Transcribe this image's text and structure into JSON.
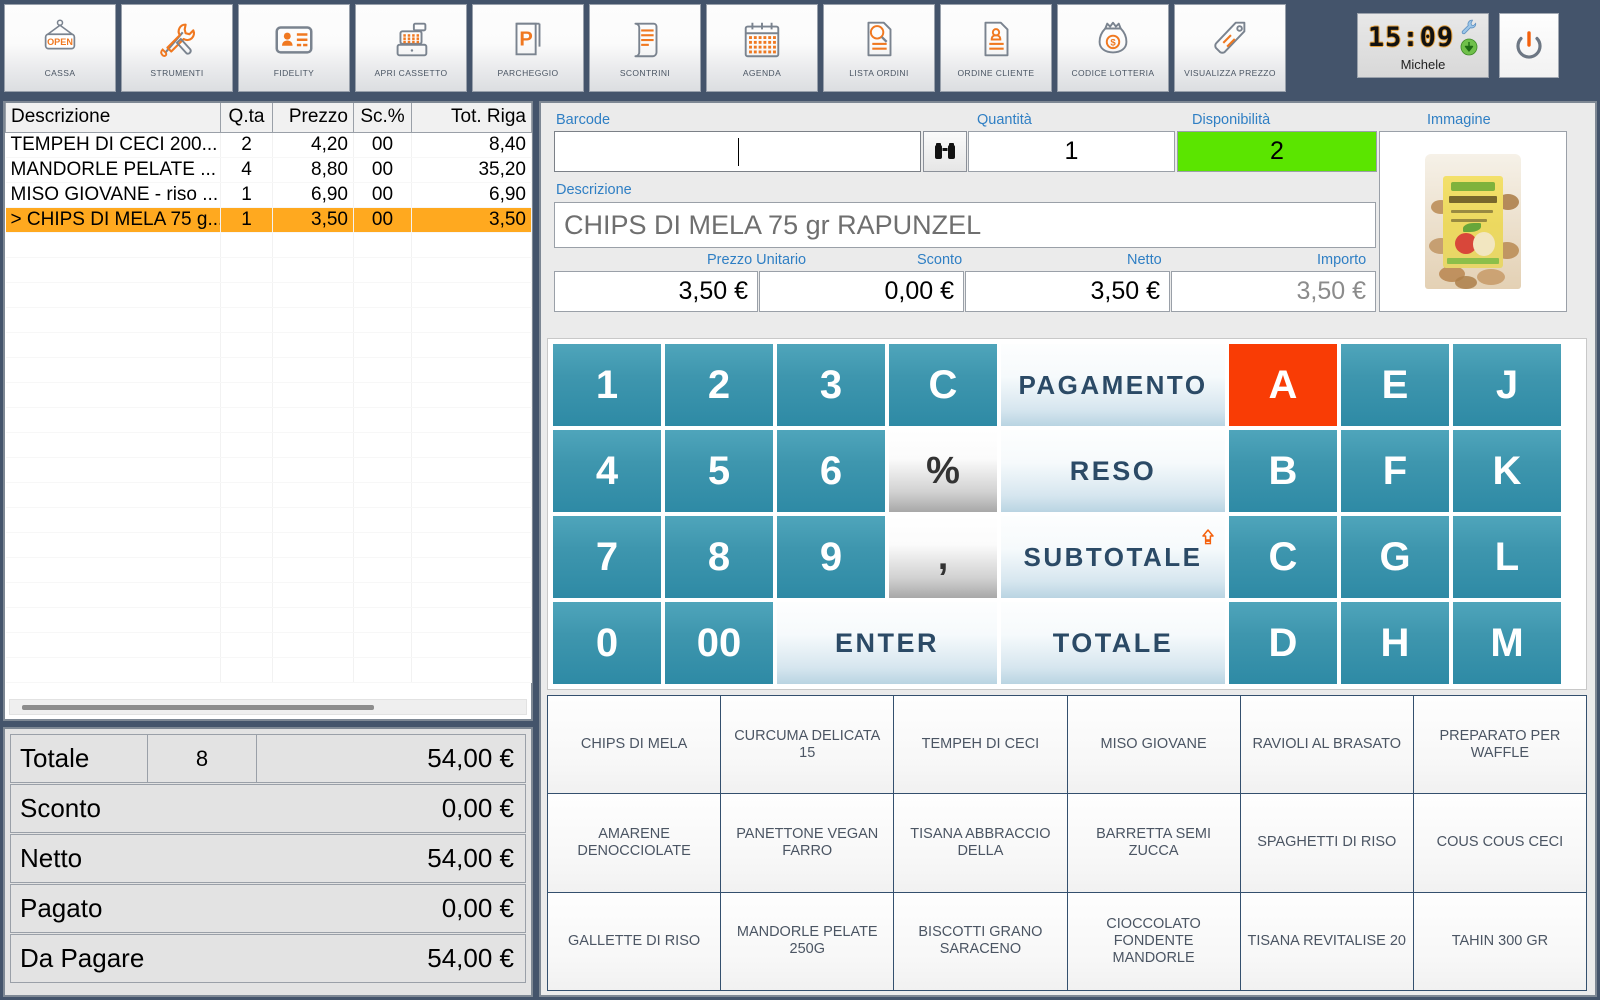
{
  "toolbar": {
    "buttons": [
      {
        "label": "CASSA",
        "icon": "open-sign-icon"
      },
      {
        "label": "STRUMENTI",
        "icon": "tools-icon"
      },
      {
        "label": "FIDELITY",
        "icon": "id-card-icon"
      },
      {
        "label": "APRI CASSETTO",
        "icon": "cash-register-icon"
      },
      {
        "label": "PARCHEGGIO",
        "icon": "parking-icon"
      },
      {
        "label": "SCONTRINI",
        "icon": "receipt-icon"
      },
      {
        "label": "AGENDA",
        "icon": "calendar-icon"
      },
      {
        "label": "LISTA ORDINI",
        "icon": "order-search-icon"
      },
      {
        "label": "ORDINE CLIENTE",
        "icon": "customer-order-icon"
      },
      {
        "label": "CODICE LOTTERIA",
        "icon": "money-bag-icon"
      },
      {
        "label": "VISUALIZZA PREZZO",
        "icon": "price-tag-icon"
      }
    ],
    "clock": {
      "time": "15:09",
      "user": "Michele"
    }
  },
  "receipt": {
    "columns": [
      "Descrizione",
      "Q.ta",
      "Prezzo",
      "Sc.%",
      "Tot. Riga"
    ],
    "rows": [
      {
        "desc": "TEMPEH DI CECI 200...",
        "qta": "2",
        "prezzo": "4,20",
        "sc": "00",
        "tot": "8,40",
        "selected": false
      },
      {
        "desc": "MANDORLE PELATE ...",
        "qta": "4",
        "prezzo": "8,80",
        "sc": "00",
        "tot": "35,20",
        "selected": false
      },
      {
        "desc": "MISO GIOVANE -  riso ...",
        "qta": "1",
        "prezzo": "6,90",
        "sc": "00",
        "tot": "6,90",
        "selected": false
      },
      {
        "desc": "> CHIPS DI MELA 75 g...",
        "qta": "1",
        "prezzo": "3,50",
        "sc": "00",
        "tot": "3,50",
        "selected": true
      }
    ]
  },
  "totals": [
    {
      "label": "Totale",
      "qty": "8",
      "value": "54,00 €"
    },
    {
      "label": "Sconto",
      "qty": "",
      "value": "0,00 €"
    },
    {
      "label": "Netto",
      "qty": "",
      "value": "54,00 €"
    },
    {
      "label": "Pagato",
      "qty": "",
      "value": "0,00 €"
    },
    {
      "label": "Da Pagare",
      "qty": "",
      "value": "54,00 €"
    }
  ],
  "detail": {
    "barcode_label": "Barcode",
    "barcode_value": "",
    "quantita_label": "Quantità",
    "quantita_value": "1",
    "disponibilita_label": "Disponibilità",
    "disponibilita_value": "2",
    "immagine_label": "Immagine",
    "descrizione_label": "Descrizione",
    "descrizione_value": "CHIPS DI MELA 75 gr RAPUNZEL",
    "prezzo_unitario_label": "Prezzo Unitario",
    "prezzo_unitario_value": "3,50 €",
    "sconto_label": "Sconto",
    "sconto_value": "0,00 €",
    "netto_label": "Netto",
    "netto_value": "3,50 €",
    "importo_label": "Importo",
    "importo_value": "3,50 €",
    "search_icon": "binoculars-icon"
  },
  "keypad": {
    "keys": [
      {
        "label": "1",
        "type": "num"
      },
      {
        "label": "2",
        "type": "num"
      },
      {
        "label": "3",
        "type": "num"
      },
      {
        "label": "C",
        "type": "num"
      },
      {
        "label": "PAGAMENTO",
        "type": "act"
      },
      {
        "label": "A",
        "type": "ltr-hot"
      },
      {
        "label": "E",
        "type": "ltr"
      },
      {
        "label": "J",
        "type": "ltr"
      },
      {
        "label": "4",
        "type": "num"
      },
      {
        "label": "5",
        "type": "num"
      },
      {
        "label": "6",
        "type": "num"
      },
      {
        "label": "%",
        "type": "gray"
      },
      {
        "label": "RESO",
        "type": "act"
      },
      {
        "label": "B",
        "type": "ltr"
      },
      {
        "label": "F",
        "type": "ltr"
      },
      {
        "label": "K",
        "type": "ltr"
      },
      {
        "label": "7",
        "type": "num"
      },
      {
        "label": "8",
        "type": "num"
      },
      {
        "label": "9",
        "type": "num"
      },
      {
        "label": ",",
        "type": "gray"
      },
      {
        "label": "SUBTOTALE",
        "type": "act-arrow"
      },
      {
        "label": "C",
        "type": "ltr"
      },
      {
        "label": "G",
        "type": "ltr"
      },
      {
        "label": "L",
        "type": "ltr"
      },
      {
        "label": "0",
        "type": "num"
      },
      {
        "label": "00",
        "type": "num"
      },
      {
        "label": "ENTER",
        "type": "act"
      },
      {
        "label": "TOTALE",
        "type": "act"
      },
      {
        "label": "D",
        "type": "ltr"
      },
      {
        "label": "H",
        "type": "ltr"
      },
      {
        "label": "M",
        "type": "ltr"
      }
    ]
  },
  "products": [
    "CHIPS DI MELA",
    "CURCUMA DELICATA 15",
    "TEMPEH DI CECI",
    "MISO GIOVANE",
    "RAVIOLI AL BRASATO",
    "PREPARATO PER WAFFLE",
    "AMARENE DENOCCIOLATE",
    "PANETTONE VEGAN FARRO",
    "TISANA ABBRACCIO DELLA",
    "BARRETTA SEMI ZUCCA",
    "SPAGHETTI DI RISO",
    "COUS COUS CECI",
    "GALLETTE DI RISO",
    "MANDORLE PELATE 250G",
    "BISCOTTI GRANO SARACENO",
    "CIOCCOLATO FONDENTE MANDORLE",
    "TISANA REVITALISE 20",
    "TAHIN 300 GR"
  ],
  "colors": {
    "chrome": "#44546b",
    "teal": "#3e96ae",
    "hot": "#F93C05",
    "selected_row": "#FFA91F",
    "available_green": "#5BE500",
    "accent_orange": "#F07820",
    "label_blue": "#2f7fc4"
  }
}
